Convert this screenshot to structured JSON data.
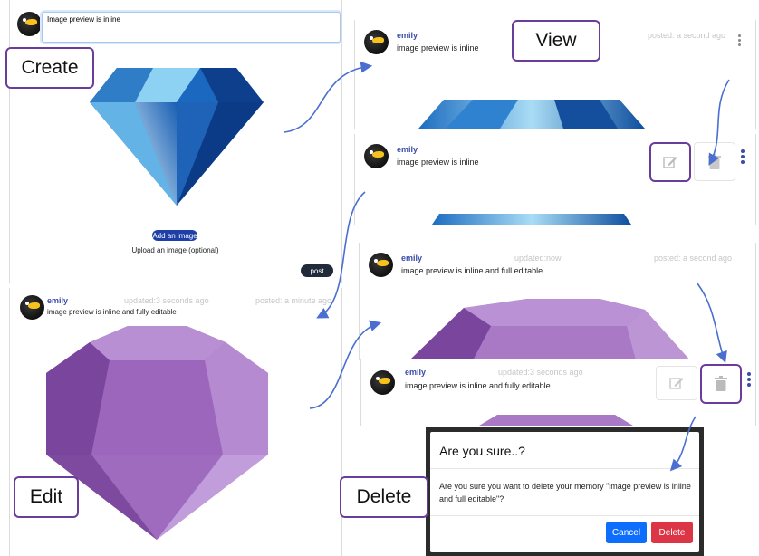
{
  "colors": {
    "accent": "#3b4ca8",
    "frame": "#6a3d9a",
    "arrow": "#4a6fd1",
    "cancel": "#0d6efd",
    "delete": "#dc3545"
  },
  "labels": {
    "create": "Create",
    "view": "View",
    "edit": "Edit",
    "delete": "Delete"
  },
  "create": {
    "input_value": "Image preview is inline",
    "add_image": "Add an image",
    "upload_hint": "Upload an image (optional)",
    "post": "post"
  },
  "view": {
    "username": "emily",
    "text": "image preview is inline",
    "posted": "posted: a second ago",
    "icons": [
      "kebab-menu-icon"
    ]
  },
  "view_actions": {
    "username": "emily",
    "text": "image preview is inline",
    "icons": [
      "edit-icon",
      "trash-icon",
      "kebab-menu-icon"
    ]
  },
  "edit": {
    "username": "emily",
    "updated": "updated:3 seconds ago",
    "posted": "posted: a minute ago",
    "text": "image preview is inline and fully editable"
  },
  "delete_a": {
    "username": "emily",
    "updated": "updated:now",
    "posted": "posted: a second ago",
    "text": "image preview is inline and full editable"
  },
  "delete_b": {
    "username": "emily",
    "updated": "updated:3 seconds ago",
    "text": "image preview is inline and fully editable",
    "icons": [
      "edit-icon",
      "trash-icon",
      "kebab-menu-icon"
    ]
  },
  "modal": {
    "title": "Are you sure..?",
    "body": "Are you sure you want to delete your memory \"image preview is inline and full editable\"?",
    "cancel": "Cancel",
    "confirm": "Delete"
  }
}
